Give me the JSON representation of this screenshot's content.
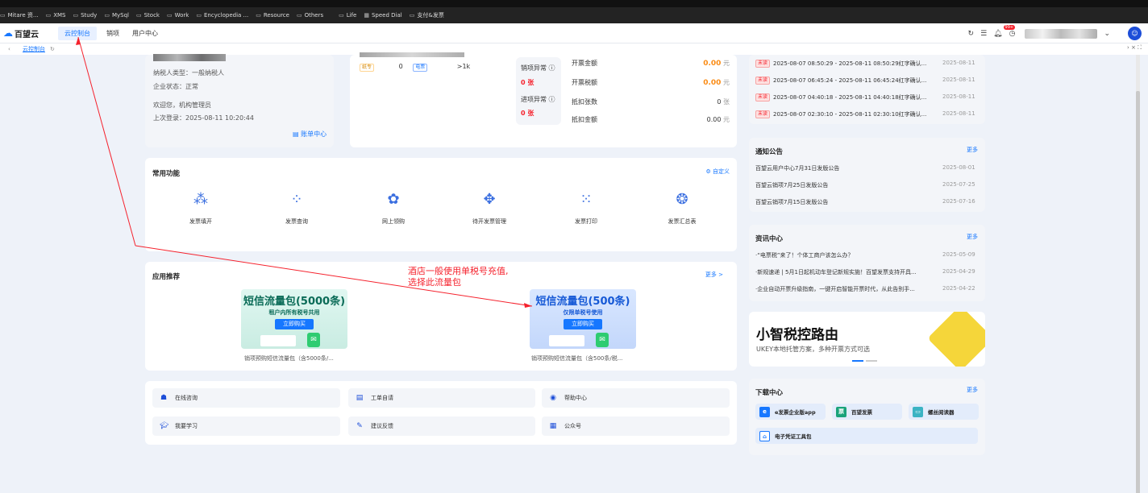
{
  "bookmarks": [
    {
      "icon": "folder-icon",
      "label": "Mitare 资..."
    },
    {
      "icon": "folder-icon",
      "label": "XMS"
    },
    {
      "icon": "folder-icon",
      "label": "Study"
    },
    {
      "icon": "folder-icon",
      "label": "MySql"
    },
    {
      "icon": "folder-icon",
      "label": "Stock"
    },
    {
      "icon": "folder-icon",
      "label": "Work"
    },
    {
      "icon": "folder-icon",
      "label": "Encyclopedia ..."
    },
    {
      "icon": "folder-icon",
      "label": "Resource"
    },
    {
      "icon": "folder-icon",
      "label": "Others"
    },
    {
      "icon": "folder-icon",
      "label": "Life"
    },
    {
      "icon": "speed-dial-icon",
      "label": "Speed Dial"
    },
    {
      "icon": "folder-icon",
      "label": "支付&发票"
    }
  ],
  "app": {
    "logo_text": "百望云",
    "nav": [
      "云控制台",
      "销项",
      "用户中心"
    ],
    "badge": "99+"
  },
  "tabbar": {
    "tab": "云控制台",
    "right": "› × ⛶"
  },
  "account": {
    "name": "（已遮挡）",
    "taxpayer_label": "纳税人类型：",
    "taxpayer": "一般纳税人",
    "status_label": "企业状态：",
    "status": "正常",
    "welcome": "欢迎您，",
    "role": "机构管理员",
    "last_login": "上次登录：",
    "last_login_time": "2025-08-11 10:20:44",
    "bill_center": "账单中心"
  },
  "invoice_mid": {
    "company": "（已遮挡）",
    "rows": [
      {
        "tag": "纸专",
        "count": "0",
        "tag2": "电票",
        "count2": ">1k"
      }
    ]
  },
  "stats": {
    "items": [
      {
        "label": "销项异常",
        "value": "0 张"
      },
      {
        "label": "进项异常",
        "value": "0 张"
      }
    ],
    "amounts": [
      {
        "label": "开票金额",
        "value": "0.00",
        "unit": "元",
        "red": true
      },
      {
        "label": "开票税额",
        "value": "0.00",
        "unit": "元",
        "red": true
      },
      {
        "label": "抵扣张数",
        "value": "0",
        "unit": "张",
        "red": false
      },
      {
        "label": "抵扣金额",
        "value": "0.00",
        "unit": "元",
        "red": false
      }
    ]
  },
  "sms_notices": [
    {
      "tag": "未读",
      "text": "2025-08-07 08:50:29 - 2025-08-11 08:50:29红字确认...",
      "date": "2025-08-11"
    },
    {
      "tag": "未读",
      "text": "2025-08-07 06:45:24 - 2025-08-11 06:45:24红字确认...",
      "date": "2025-08-11"
    },
    {
      "tag": "未读",
      "text": "2025-08-07 04:40:18 - 2025-08-11 04:40:18红字确认...",
      "date": "2025-08-11"
    },
    {
      "tag": "未读",
      "text": "2025-08-07 02:30:10 - 2025-08-11 02:30:10红字确认...",
      "date": "2025-08-11"
    }
  ],
  "common_functions": {
    "title": "常用功能",
    "customize": "自定义",
    "items": [
      {
        "label": "发票填开",
        "icon": "invoice-issue-icon"
      },
      {
        "label": "发票查询",
        "icon": "invoice-query-icon"
      },
      {
        "label": "网上领购",
        "icon": "online-purchase-icon"
      },
      {
        "label": "待开发票管理",
        "icon": "pending-invoice-icon"
      },
      {
        "label": "发票打印",
        "icon": "invoice-print-icon"
      },
      {
        "label": "发票汇总表",
        "icon": "invoice-summary-icon"
      }
    ]
  },
  "recommend": {
    "title": "应用推荐",
    "more": "更多 >",
    "items": [
      {
        "title": "短信流量包(5000条)",
        "subtitle": "租户内所有税号共用",
        "button": "立即购买",
        "caption": "销项预购短信流量包（含5000条/..."
      },
      {
        "title": "短信流量包(500条)",
        "subtitle": "仅限单税号使用",
        "button": "立即购买",
        "caption": "销项预购短信流量包（含500条/税..."
      }
    ]
  },
  "annotation": {
    "line1": "酒店一般使用单税号充值,",
    "line2": "选择此流量包"
  },
  "quick_links": [
    {
      "label": "在线咨询",
      "icon": "chat-icon"
    },
    {
      "label": "工单自请",
      "icon": "ticket-icon"
    },
    {
      "label": "帮助中心",
      "icon": "help-icon"
    },
    {
      "label": "我要学习",
      "icon": "learn-icon"
    },
    {
      "label": "建议反馈",
      "icon": "feedback-icon"
    },
    {
      "label": "公众号",
      "icon": "qrcode-icon"
    }
  ],
  "announcements": {
    "title": "通知公告",
    "more": "更多",
    "items": [
      {
        "text": "百望云用户中心7月31日发版公告",
        "date": "2025-08-01"
      },
      {
        "text": "百望云销项7月25日发版公告",
        "date": "2025-07-25"
      },
      {
        "text": "百望云销项7月15日发版公告",
        "date": "2025-07-16"
      }
    ]
  },
  "news": {
    "title": "资讯中心",
    "more": "更多",
    "items": [
      {
        "text": "·“电票税”来了！个体工商户该怎么办？",
        "date": "2025-05-09"
      },
      {
        "text": "·新规速递 | 5月1日起机动车登记新规实施！百望发票支持开具...",
        "date": "2025-04-29"
      },
      {
        "text": "·企业自动开票升级指南，一键开启智能开票时代，从此告别手...",
        "date": "2025-04-22"
      }
    ]
  },
  "banner": {
    "title": "小智税控路由",
    "subtitle": "UKEY本地托管方案，多种开票方式可选"
  },
  "downloads": {
    "title": "下载中心",
    "more": "更多",
    "items": [
      {
        "label": "e发票企业版app",
        "icon": "e-invoice-icon"
      },
      {
        "label": "百望发票",
        "icon": "baiwang-invoice-icon"
      },
      {
        "label": "螺丝阅读器",
        "icon": "reader-icon"
      },
      {
        "label": "电子凭证工具包",
        "icon": "toolkit-icon"
      }
    ]
  }
}
